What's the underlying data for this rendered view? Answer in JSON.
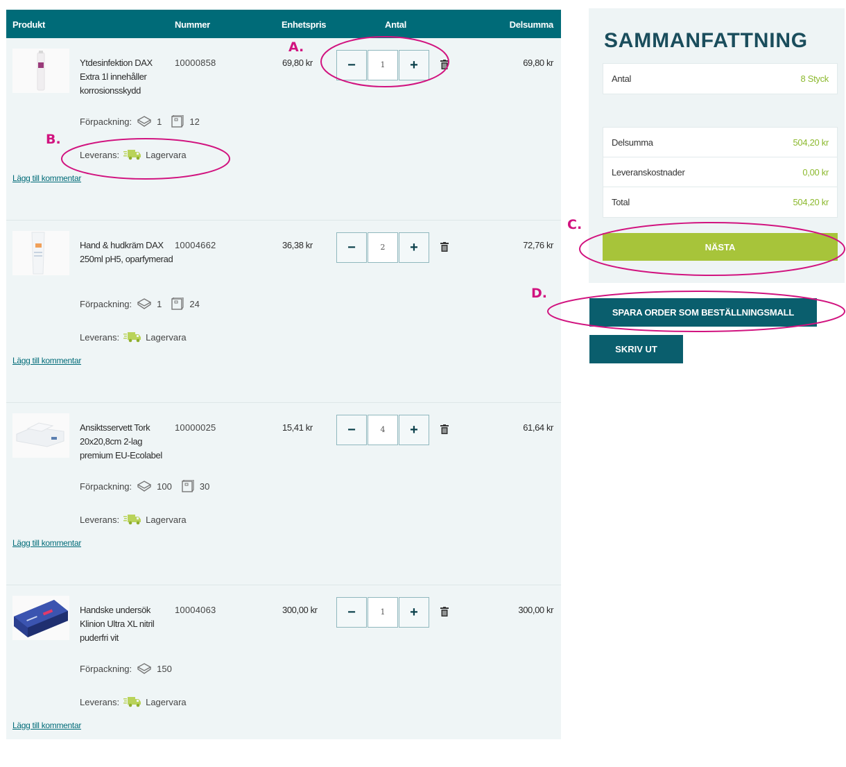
{
  "cart": {
    "headers": {
      "product": "Produkt",
      "number": "Nummer",
      "unit_price": "Enhetspris",
      "quantity": "Antal",
      "subtotal": "Delsumma"
    },
    "packaging_label": "Förpackning:",
    "delivery_label": "Leverans:",
    "comment_link": "Lägg till kommentar",
    "items": [
      {
        "name": "Ytdesinfektion DAX Extra 1l innehåller korrosionsskydd",
        "number": "10000858",
        "unit_price": "69,80 kr",
        "quantity": "1",
        "subtotal": "69,80 kr",
        "pack_units": "1",
        "pack_box": "12",
        "delivery_status": "Lagervara"
      },
      {
        "name": "Hand & hudkräm DAX 250ml pH5, oparfymerad",
        "number": "10004662",
        "unit_price": "36,38 kr",
        "quantity": "2",
        "subtotal": "72,76 kr",
        "pack_units": "1",
        "pack_box": "24",
        "delivery_status": "Lagervara"
      },
      {
        "name": "Ansiktsservett Tork 20x20,8cm 2-lag premium EU-Ecolabel",
        "number": "10000025",
        "unit_price": "15,41 kr",
        "quantity": "4",
        "subtotal": "61,64 kr",
        "pack_units": "100",
        "pack_box": "30",
        "delivery_status": "Lagervara"
      },
      {
        "name": "Handske undersök Klinion Ultra XL nitril puderfri vit",
        "number": "10004063",
        "unit_price": "300,00 kr",
        "quantity": "1",
        "subtotal": "300,00 kr",
        "pack_units": "150",
        "pack_box": "",
        "delivery_status": "Lagervara"
      }
    ]
  },
  "summary": {
    "title": "SAMMANFATTNING",
    "count_label": "Antal",
    "count_value": "8 Styck",
    "subtotal_label": "Delsumma",
    "subtotal_value": "504,20 kr",
    "shipping_label": "Leveranskostnader",
    "shipping_value": "0,00 kr",
    "total_label": "Total",
    "total_value": "504,20 kr",
    "next_button": "NÄSTA",
    "save_template_button": "SPARA ORDER SOM BESTÄLLNINGSMALL",
    "print_button": "SKRIV UT"
  },
  "annotations": {
    "a": "A.",
    "b": "B.",
    "c": "C.",
    "d": "D."
  },
  "colors": {
    "header_teal": "#006b78",
    "button_teal": "#0a5e6d",
    "accent_green": "#a7c43a",
    "value_green": "#8cb92e",
    "annotation_magenta": "#d1137f"
  },
  "icons": {
    "minus": "minus-icon",
    "plus": "plus-icon",
    "trash": "trash-icon",
    "package": "package-icon",
    "box": "box-icon",
    "truck": "truck-icon"
  }
}
